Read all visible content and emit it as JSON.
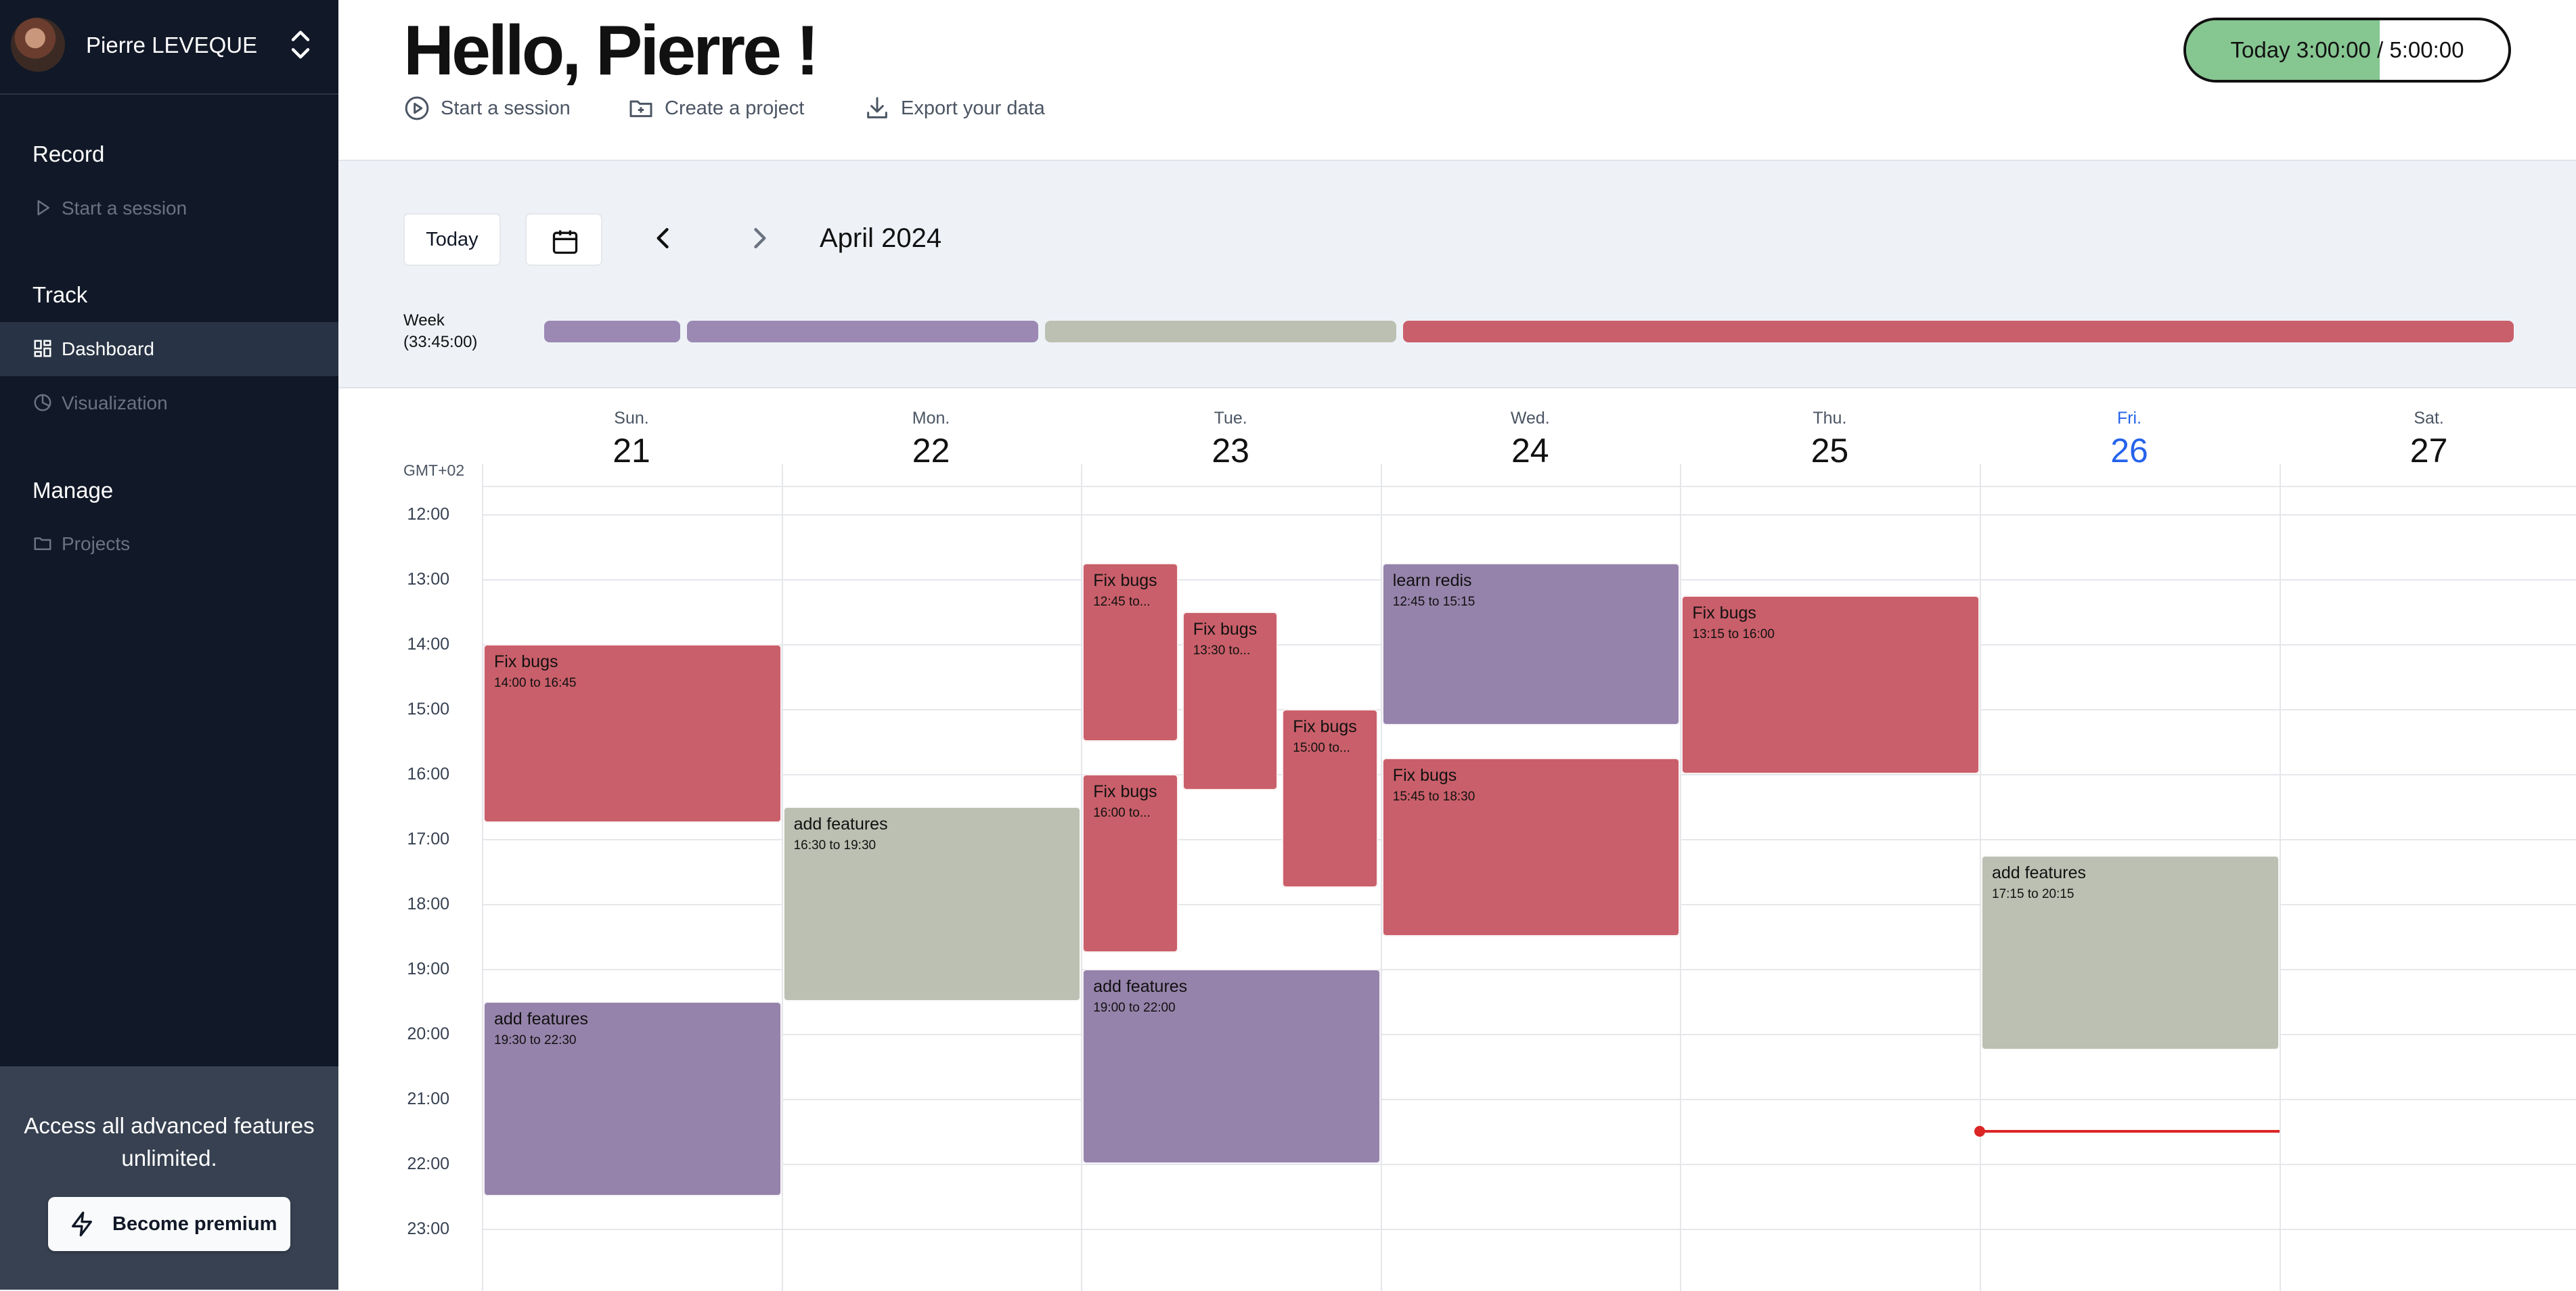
{
  "user": {
    "name": "Pierre LEVEQUE"
  },
  "sidebar": {
    "sections": [
      {
        "title": "Record",
        "items": [
          {
            "label": "Start a session",
            "icon": "play-icon",
            "active": false
          }
        ]
      },
      {
        "title": "Track",
        "items": [
          {
            "label": "Dashboard",
            "icon": "dashboard-icon",
            "active": true
          },
          {
            "label": "Visualization",
            "icon": "chart-icon",
            "active": false
          }
        ]
      },
      {
        "title": "Manage",
        "items": [
          {
            "label": "Projects",
            "icon": "folder-icon",
            "active": false
          }
        ]
      }
    ],
    "collapse_label": "«",
    "promo": {
      "text": "Access all advanced features unlimited.",
      "button_label": "Become premium"
    }
  },
  "header": {
    "greeting": "Hello, Pierre !",
    "actions": [
      {
        "label": "Start a session",
        "icon": "play-circle-icon"
      },
      {
        "label": "Create a project",
        "icon": "folder-plus-icon"
      },
      {
        "label": "Export your data",
        "icon": "download-icon"
      }
    ],
    "timer": {
      "text": "Today 3:00:00 / 5:00:00",
      "progress": 0.6,
      "color": "#86c691"
    }
  },
  "toolbar": {
    "today_label": "Today",
    "month_label": "April 2024"
  },
  "week_summary": {
    "label_line1": "Week",
    "label_line2": "(33:45:00)",
    "segments": [
      {
        "color": "#9b89b4",
        "share": 0.119
      },
      {
        "color": "#9b89b4",
        "share": 0.307
      },
      {
        "color": "#bcc0b2",
        "share": 0.307
      },
      {
        "color": "#c95f6a",
        "share": 0.971
      }
    ]
  },
  "calendar": {
    "timezone_label": "GMT+02",
    "days": [
      {
        "name": "Sun.",
        "num": "21",
        "today": false
      },
      {
        "name": "Mon.",
        "num": "22",
        "today": false
      },
      {
        "name": "Tue.",
        "num": "23",
        "today": false
      },
      {
        "name": "Wed.",
        "num": "24",
        "today": false
      },
      {
        "name": "Thu.",
        "num": "25",
        "today": false
      },
      {
        "name": "Fri.",
        "num": "26",
        "today": true
      },
      {
        "name": "Sat.",
        "num": "27",
        "today": false
      }
    ],
    "hours": [
      "12:00",
      "13:00",
      "14:00",
      "15:00",
      "16:00",
      "17:00",
      "18:00",
      "19:00",
      "20:00",
      "21:00",
      "22:00",
      "23:00"
    ],
    "first_hour": 12,
    "now": {
      "day": 5,
      "time": 21.5
    },
    "events": [
      {
        "day": 0,
        "col": 0,
        "cols": 1,
        "start": 14.0,
        "end": 16.75,
        "title": "Fix bugs",
        "time": "14:00 to 16:45",
        "color": "#c95f6a"
      },
      {
        "day": 0,
        "col": 0,
        "cols": 1,
        "start": 19.5,
        "end": 22.5,
        "title": "add features",
        "time": "19:30 to 22:30",
        "color": "#9683ab"
      },
      {
        "day": 1,
        "col": 0,
        "cols": 1,
        "start": 16.5,
        "end": 19.5,
        "title": "add features",
        "time": "16:30 to 19:30",
        "color": "#bcc0b2"
      },
      {
        "day": 2,
        "col": 0,
        "cols": 3,
        "start": 12.75,
        "end": 15.5,
        "title": "Fix bugs",
        "time": "12:45 to...",
        "color": "#c95f6a"
      },
      {
        "day": 2,
        "col": 1,
        "cols": 3,
        "start": 13.5,
        "end": 16.25,
        "title": "Fix bugs",
        "time": "13:30 to...",
        "color": "#c95f6a"
      },
      {
        "day": 2,
        "col": 2,
        "cols": 3,
        "start": 15.0,
        "end": 17.75,
        "title": "Fix bugs",
        "time": "15:00 to...",
        "color": "#c95f6a"
      },
      {
        "day": 2,
        "col": 0,
        "cols": 3,
        "start": 16.0,
        "end": 18.75,
        "title": "Fix bugs",
        "time": "16:00 to...",
        "color": "#c95f6a"
      },
      {
        "day": 2,
        "col": 0,
        "cols": 1,
        "start": 19.0,
        "end": 22.0,
        "title": "add features",
        "time": "19:00 to 22:00",
        "color": "#9683ab"
      },
      {
        "day": 3,
        "col": 0,
        "cols": 1,
        "start": 12.75,
        "end": 15.25,
        "title": "learn redis",
        "time": "12:45 to 15:15",
        "color": "#9683ab"
      },
      {
        "day": 3,
        "col": 0,
        "cols": 1,
        "start": 15.75,
        "end": 18.5,
        "title": "Fix bugs",
        "time": "15:45 to 18:30",
        "color": "#c95f6a"
      },
      {
        "day": 4,
        "col": 0,
        "cols": 1,
        "start": 13.25,
        "end": 16.0,
        "title": "Fix bugs",
        "time": "13:15 to 16:00",
        "color": "#c95f6a"
      },
      {
        "day": 5,
        "col": 0,
        "cols": 1,
        "start": 17.25,
        "end": 20.25,
        "title": "add features",
        "time": "17:15 to 20:15",
        "color": "#bcc0b2"
      }
    ]
  }
}
